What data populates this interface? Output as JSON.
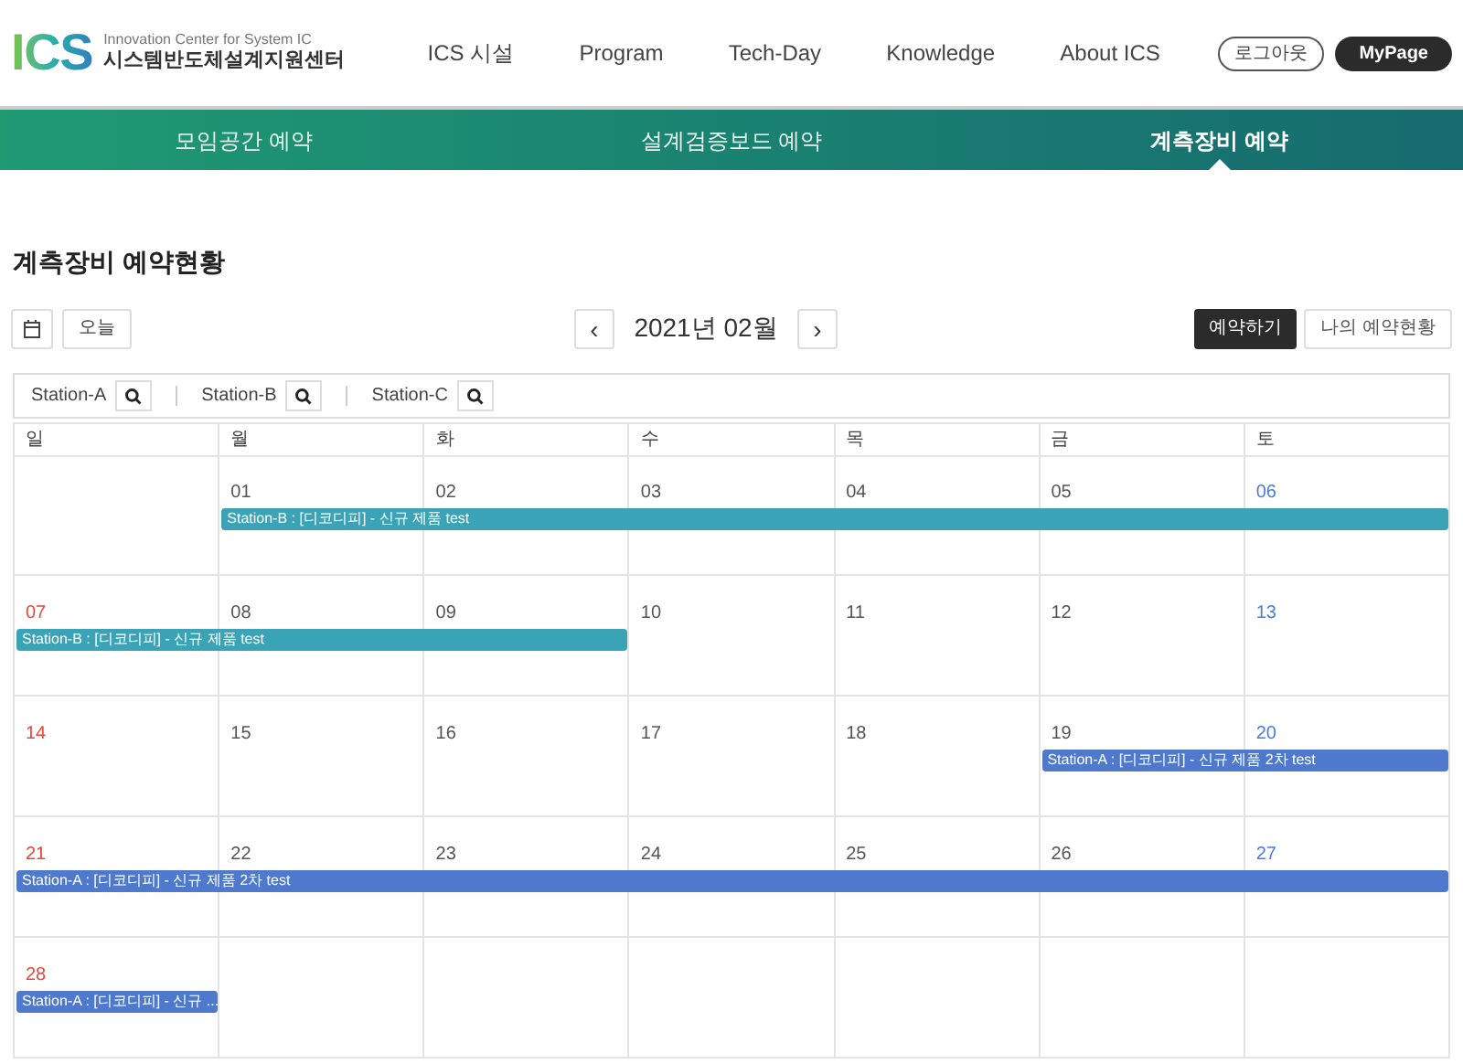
{
  "header": {
    "logo": {
      "mark": "ICS",
      "subtitle": "Innovation Center for System IC",
      "name": "시스템반도체설계지원센터"
    },
    "menu": [
      "ICS 시설",
      "Program",
      "Tech-Day",
      "Knowledge",
      "About ICS"
    ],
    "logout": "로그아웃",
    "mypage": "MyPage"
  },
  "tabs": [
    {
      "label": "모임공간 예약",
      "selected": false
    },
    {
      "label": "설계검증보드 예약",
      "selected": false
    },
    {
      "label": "계측장비 예약",
      "selected": true
    }
  ],
  "page_title": "계측장비 예약현황",
  "toolbar": {
    "today": "오늘",
    "month": "2021년 02월",
    "prev": "‹",
    "next": "›",
    "reserve": "예약하기",
    "my_reservations": "나의 예약현황"
  },
  "stations": [
    "Station-A",
    "Station-B",
    "Station-C"
  ],
  "calendar": {
    "weekdays": [
      "일",
      "월",
      "화",
      "수",
      "목",
      "금",
      "토"
    ],
    "weeks": [
      {
        "leading_blank": true,
        "days": [
          {
            "date": "01",
            "event": {
              "text": "Station-B : [디코디피] - 신규 제품 test",
              "color": "#3aa3b5"
            }
          },
          {
            "date": "02",
            "event_continues": true
          },
          {
            "date": "03",
            "event_continues": true
          },
          {
            "date": "04",
            "event_continues": true
          },
          {
            "date": "05",
            "event_continues": true
          },
          {
            "date": "06",
            "event_continues": true
          }
        ]
      },
      {
        "days": [
          {
            "date": "07",
            "event": {
              "text": "Station-B : [디코디피] - 신규 제품 test",
              "color": "#3aa3b5"
            }
          },
          {
            "date": "08",
            "event_continues": true
          },
          {
            "date": "09",
            "event_continues": true
          },
          {
            "date": "10"
          },
          {
            "date": "11"
          },
          {
            "date": "12"
          },
          {
            "date": "13"
          }
        ]
      },
      {
        "days": [
          {
            "date": "14"
          },
          {
            "date": "15"
          },
          {
            "date": "16"
          },
          {
            "date": "17"
          },
          {
            "date": "18"
          },
          {
            "date": "19",
            "event": {
              "text": "Station-A : [디코디피] - 신규 제품 2차 test",
              "color": "#4f79cd"
            }
          },
          {
            "date": "20",
            "event_continues": true
          }
        ]
      },
      {
        "days": [
          {
            "date": "21",
            "event": {
              "text": "Station-A : [디코디피] - 신규 제품 2차 test",
              "color": "#4f79cd"
            }
          },
          {
            "date": "22",
            "event_continues": true
          },
          {
            "date": "23",
            "event_continues": true
          },
          {
            "date": "24",
            "event_continues": true
          },
          {
            "date": "25",
            "event_continues": true
          },
          {
            "date": "26",
            "event_continues": true
          },
          {
            "date": "27",
            "event_continues": true
          }
        ]
      },
      {
        "days": [
          {
            "date": "28",
            "event": {
              "text": "Station-A : [디코디피] - 신규 ...",
              "color": "#4f79cd"
            }
          }
        ]
      }
    ]
  }
}
